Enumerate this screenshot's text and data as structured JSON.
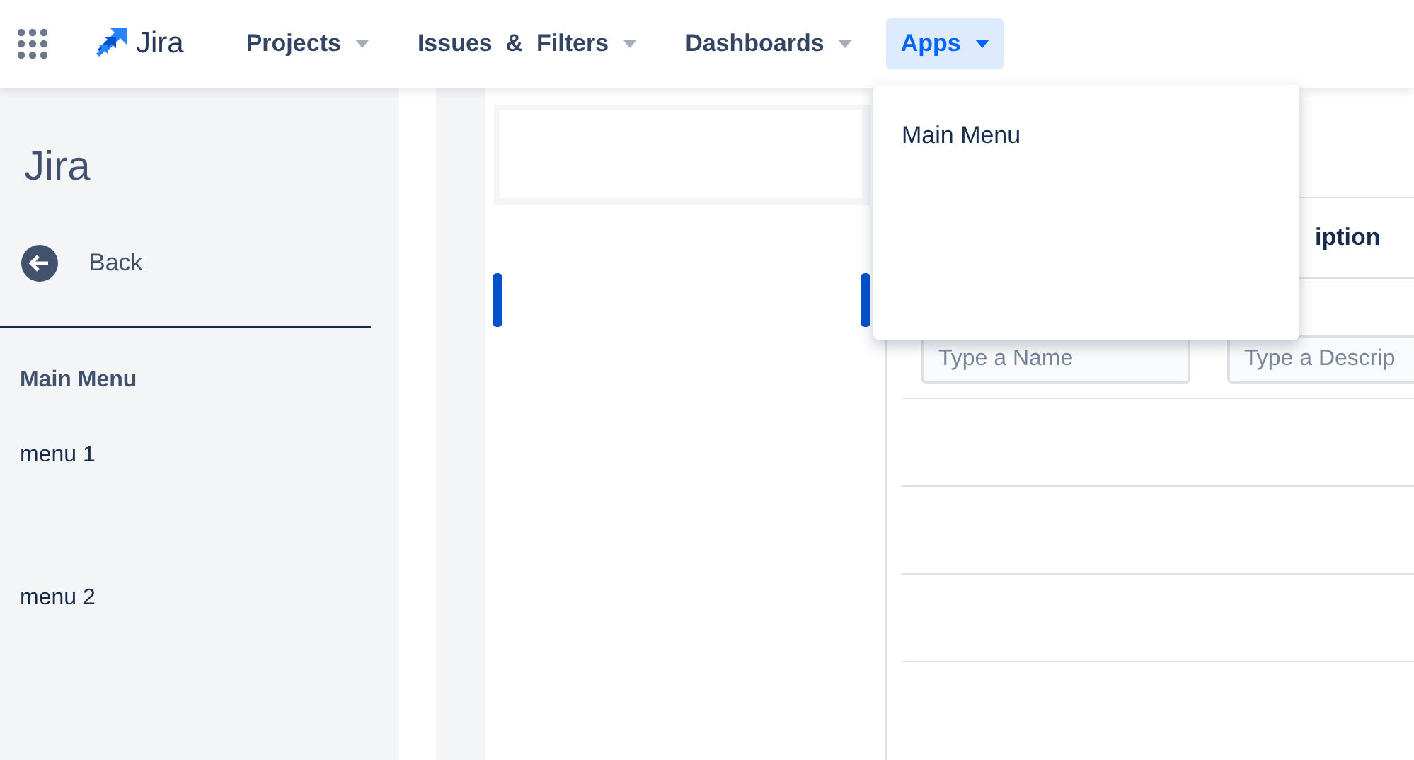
{
  "nav": {
    "product": "Jira",
    "items": [
      {
        "label": "Projects",
        "selected": false
      },
      {
        "label": "Issues  &  Filters",
        "selected": false
      },
      {
        "label": "Dashboards",
        "selected": false
      },
      {
        "label": "Apps",
        "selected": true
      }
    ]
  },
  "sidebar": {
    "title": "Jira",
    "back": "Back",
    "section": "Main Menu",
    "items": [
      "menu 1",
      "menu 2"
    ]
  },
  "table": {
    "header": "iption",
    "placeholders": [
      "Type a Name",
      "Type a Descrip"
    ]
  },
  "dropdown": {
    "items": [
      "Main Menu"
    ]
  }
}
